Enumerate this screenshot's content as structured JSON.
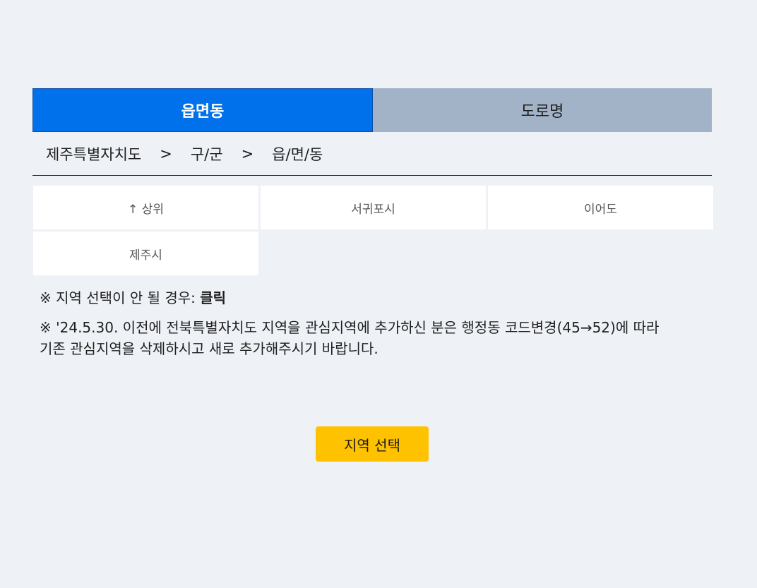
{
  "tabs": {
    "eupmyeondong": "읍면동",
    "doromyeong": "도로명"
  },
  "breadcrumb": {
    "level1": "제주특별자치도",
    "level2": "구/군",
    "level3": "읍/면/동",
    "separator": ">"
  },
  "regions": {
    "up": "↑ 상위",
    "items": [
      "서귀포시",
      "이어도",
      "제주시"
    ]
  },
  "notes": {
    "note1_prefix": "※ 지역 선택이 안 될 경우: ",
    "note1_click": "클릭",
    "note2_line1": "※ '24.5.30. 이전에 전북특별자치도 지역을 관심지역에 추가하신 분은 행정동 코드변경(45→52)에 따라",
    "note2_line2": "기존 관심지역을 삭제하시고 새로 추가해주시기 바랍니다."
  },
  "select_button": "지역 선택",
  "colors": {
    "active_tab": "#0070eb",
    "inactive_tab": "#a2b3c7",
    "select_button": "#ffc200",
    "background": "#eef1f6"
  }
}
